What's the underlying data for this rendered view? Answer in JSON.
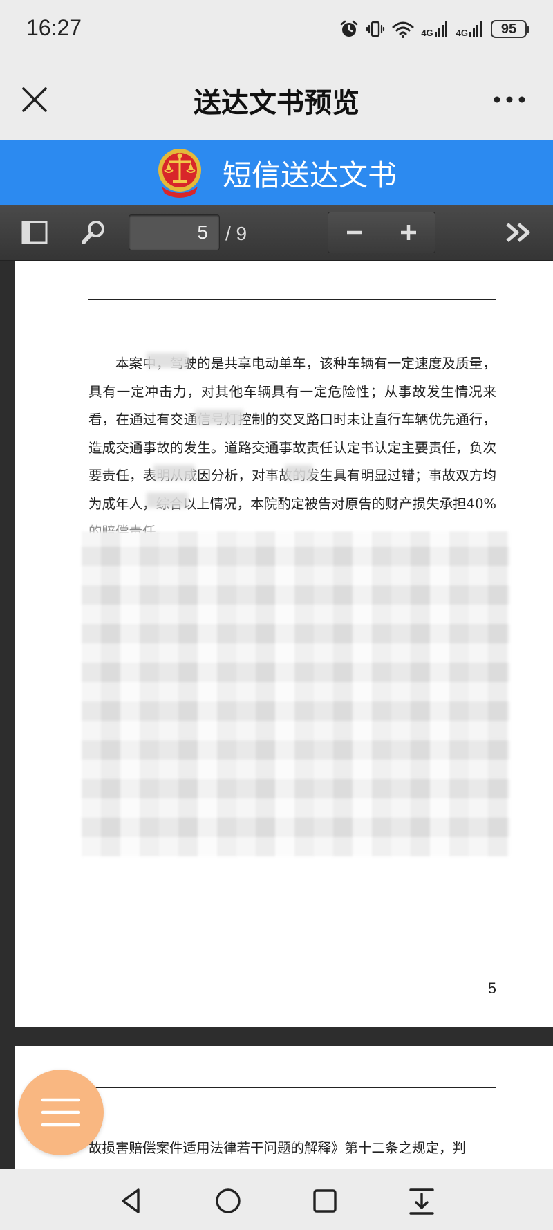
{
  "status_bar": {
    "time": "16:27",
    "network_1": "4G",
    "network_2": "4G",
    "battery": "95"
  },
  "title_bar": {
    "title": "送达文书预览"
  },
  "banner": {
    "title": "短信送达文书"
  },
  "pdf_toolbar": {
    "current_page": "5",
    "total_pages": "/ 9"
  },
  "document": {
    "page_5": {
      "paragraph": "本案中，驾驶的是共享电动单车，该种车辆有一定速度及质量，具有一定冲击力，对其他车辆具有一定危险性；从事故发生情况来看，在通过有交通信号灯控制的交叉路口时未让直行车辆优先通行，造成交通事故的发生。道路交通事故责任认定书认定主要责任，负次要责任，表明从成因分析，对事故的发生具有明显过错；事故双方均为成年人，综合以上情况，本院酌定被告对原告的财产损失承担40%的赔偿责任。",
      "page_number": "5"
    },
    "page_6": {
      "paragraph": "故损害赔偿案件适用法律若干问题的解释》第十二条之规定，判"
    }
  },
  "colors": {
    "banner_blue": "#2c8af0",
    "toolbar_dark": "#3f3f3f",
    "fab_orange": "#f9b781"
  }
}
